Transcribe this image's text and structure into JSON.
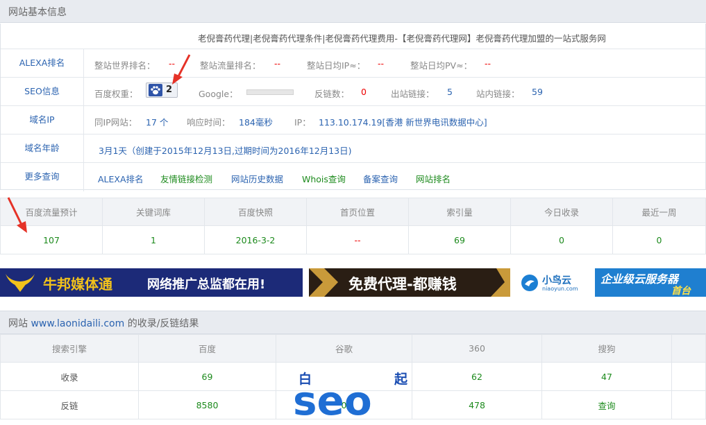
{
  "basic_info": {
    "header": "网站基本信息",
    "site_title": "老倪膏药代理|老倪膏药代理条件|老倪膏药代理费用-【老倪膏药代理网】老倪膏药代理加盟的一站式服务网",
    "alexa": {
      "label": "ALEXA排名",
      "world_rank_label": "整站世界排名：",
      "world_rank_value": "--",
      "traffic_rank_label": "整站流量排名：",
      "traffic_rank_value": "--",
      "daily_ip_label": "整站日均IP≈：",
      "daily_ip_value": "--",
      "daily_pv_label": "整站日均PV≈：",
      "daily_pv_value": "--"
    },
    "seo": {
      "label": "SEO信息",
      "baidu_weight_label": "百度权重：",
      "baidu_weight_value": "2",
      "google_label": "Google：",
      "backlinks_label": "反链数：",
      "backlinks_value": "0",
      "outbound_label": "出站链接：",
      "outbound_value": "5",
      "internal_label": "站内链接：",
      "internal_value": "59"
    },
    "domain_ip": {
      "label": "域名IP",
      "same_ip_label": "同IP网站：",
      "same_ip_value": "17 个",
      "response_label": "响应时间：",
      "response_value": "184毫秒",
      "ip_label": "IP：",
      "ip_value": "113.10.174.19[香港 新世界电讯数据中心]"
    },
    "domain_age": {
      "label": "域名年龄",
      "value": "3月1天（创建于2015年12月13日,过期时间为2016年12月13日)"
    },
    "more": {
      "label": "更多查询",
      "links": [
        "ALEXA排名",
        "友情链接检测",
        "网站历史数据",
        "Whois查询",
        "备案查询",
        "网站排名"
      ]
    }
  },
  "stats": {
    "headers": [
      "百度流量预计",
      "关键词库",
      "百度快照",
      "首页位置",
      "索引量",
      "今日收录",
      "最近一周"
    ],
    "values": [
      "107",
      "1",
      "2016-3-2",
      "--",
      "69",
      "0",
      "0"
    ]
  },
  "banners": {
    "b1_brand": "牛邦媒体通",
    "b1_slogan": "网络推广总监都在用!",
    "b2_text": "免费代理-都赚钱",
    "b3_brand": "小鸟云",
    "b3_domain": "niaoyun.com",
    "b3_slogan": "企业级云服务器",
    "b3_badge": "首台"
  },
  "results": {
    "header_prefix": "网站 ",
    "domain": "www.laonidaili.com",
    "header_suffix": " 的收录/反链结果",
    "headers": [
      "搜索引擎",
      "百度",
      "谷歌",
      "360",
      "搜狗"
    ],
    "rows": [
      {
        "label": "收录",
        "baidu": "69",
        "google": "",
        "s360": "62",
        "sogou": "47"
      },
      {
        "label": "反链",
        "baidu": "8580",
        "google": "0",
        "s360": "478",
        "sogou": "查询"
      }
    ]
  },
  "watermark": {
    "left_char": "白",
    "right_char": "起",
    "word": "seo"
  },
  "colors": {
    "link_blue": "#2b63b0",
    "value_red": "#e00000",
    "value_green": "#1c8a1c",
    "header_bg": "#e8ebf0",
    "annotation_red": "#e53227"
  }
}
